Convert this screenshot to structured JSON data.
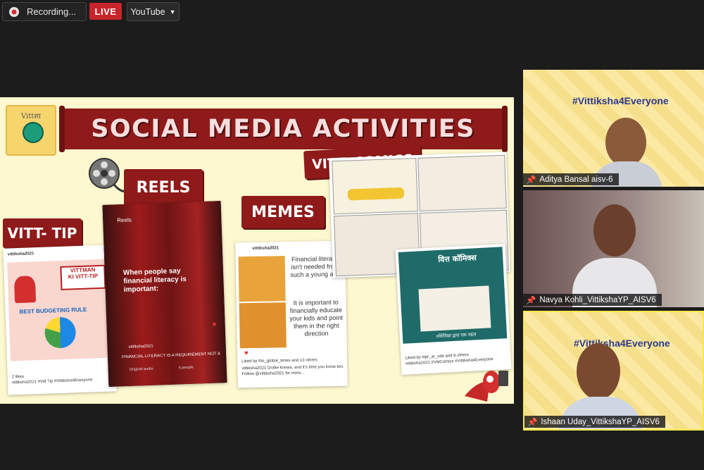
{
  "topbar": {
    "recording_label": "Recording...",
    "live_label": "LIVE",
    "youtube_label": "YouTube",
    "recording_icon": "recording-cloud-icon",
    "dropdown_icon": "caret-down-icon"
  },
  "slide": {
    "title": "SOCIAL MEDIA ACTIVITIES",
    "logo_text": "Vittशा",
    "tags": {
      "vitt_tip": "VITT- TIP",
      "reels": "REELS",
      "memes": "MEMES",
      "vitt_comics": "VITT- COMICS"
    },
    "tip_post": {
      "account": "vittiksha2021",
      "headline1": "VITTMAN",
      "headline2": "KI VITT-TIP",
      "rule": "BEST BUDGETING RULE",
      "likes": "2 likes",
      "caption": "vittiksha2021 #Vitt Tip #Vittiksha4Everyone"
    },
    "reel_post": {
      "header": "Reels",
      "overlay_text": "When people say financial literacy is important:",
      "account": "vittiksha2021",
      "caption": "FINANCIAL LITERACY IS A REQUIREMENT NOT A ...",
      "audio": "Original audio",
      "people": "4 people"
    },
    "meme_post": {
      "account": "vittiksha2021",
      "text_top": "Financial literacy isn't needed from such a young age",
      "text_bottom": "It is important to financially educate your kids and point them in the right direction",
      "liked_by": "Liked by the_global_times and 13 others",
      "caption": "vittiksha2021 Drake knows, and it's time you know too. Follow @vittiksha2021 for more...",
      "more": "more"
    },
    "comic_post": {
      "title": "वित्त कॉमिक्स",
      "footer": "#वित्तिक्षा द्वारा एक पहल",
      "liked_by": "Liked by klpr_ar_cdd and 6 others",
      "caption": "vittiksha2021 #VittComics #Vittiksha4Everyone"
    }
  },
  "participants": [
    {
      "name": "Aditya Bansal aisv-6",
      "banner": "#Vittiksha4Everyone"
    },
    {
      "name": "Navya Kohli_VittikshaYP_AISV6",
      "banner": ""
    },
    {
      "name": "Ishaan Uday_VittikshaYP_AISV6",
      "banner": "#Vittiksha4Everyone"
    }
  ],
  "colors": {
    "live": "#c8242b",
    "slide_bg": "#fdf8cf",
    "maroon": "#8f1a1a",
    "speaker_border": "#f4e94a"
  }
}
